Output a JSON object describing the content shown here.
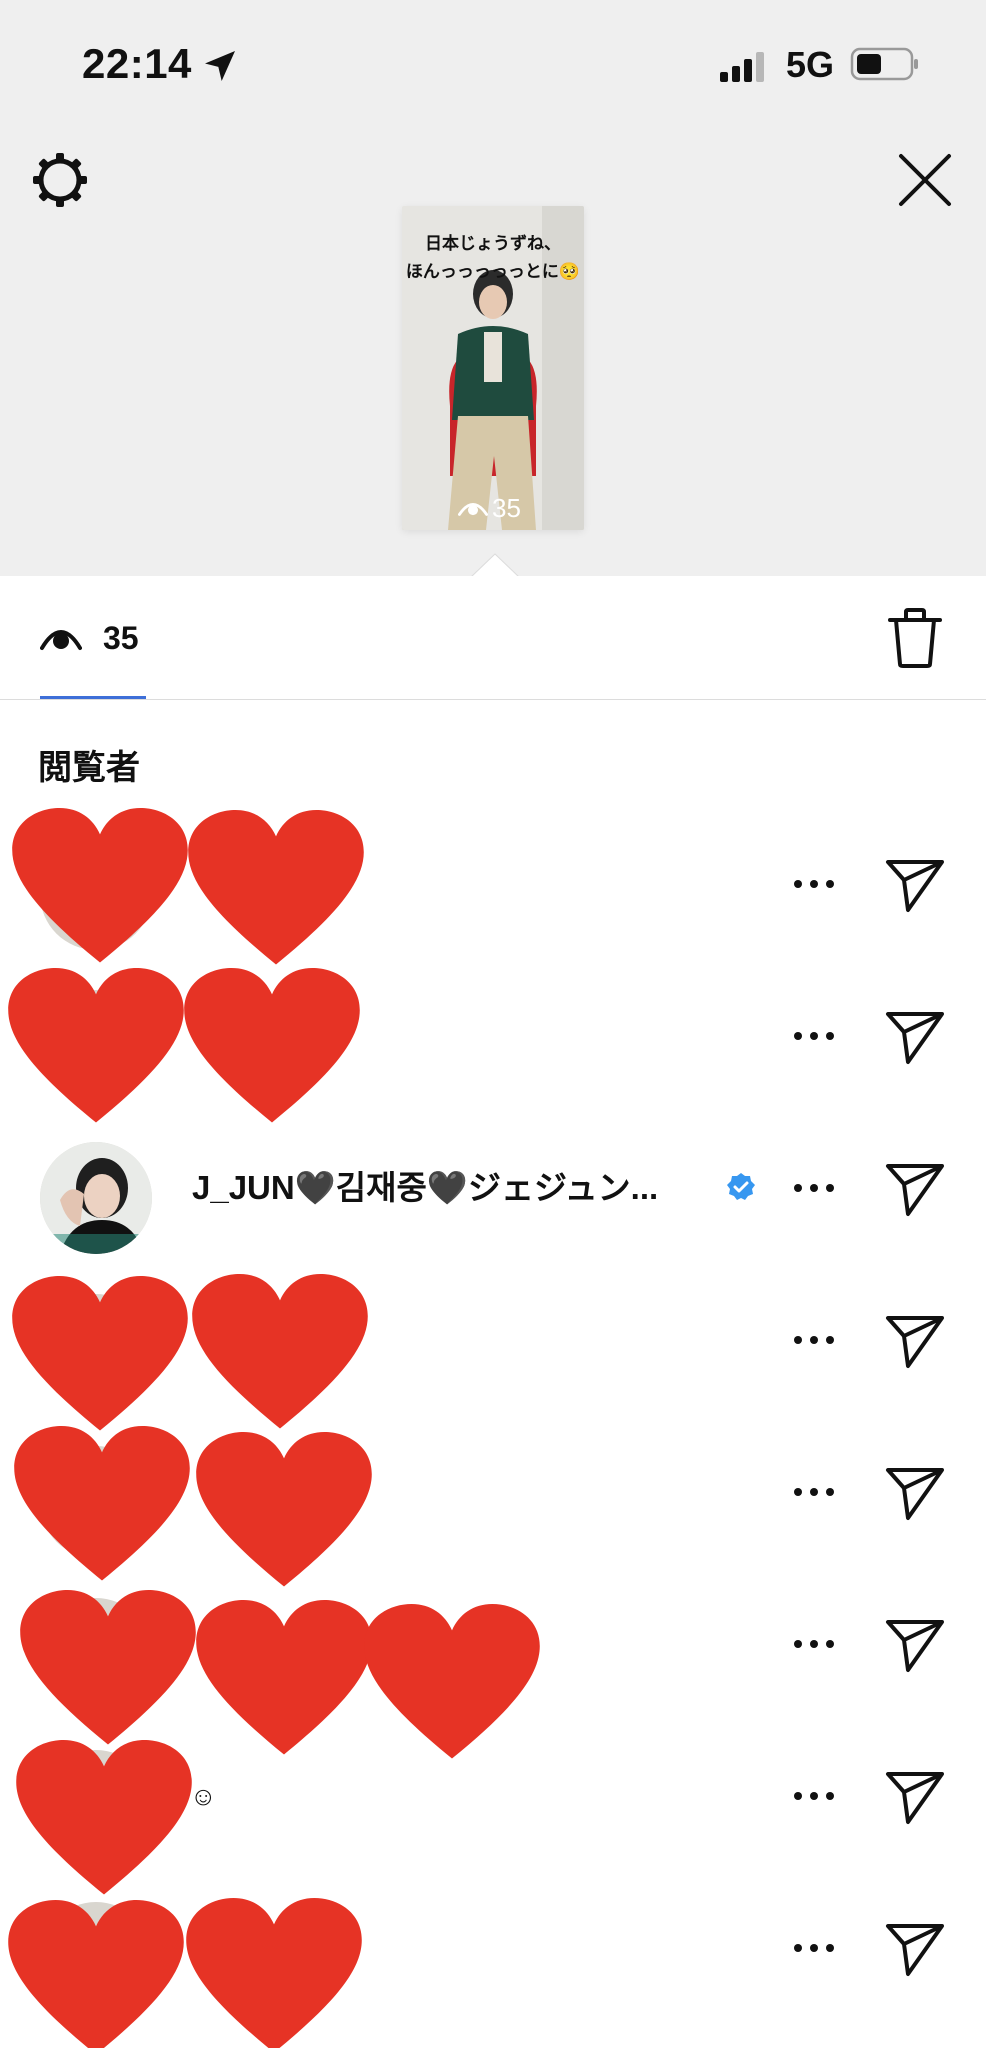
{
  "status_bar": {
    "time": "22:14",
    "network": "5G",
    "icons": [
      "location-arrow-icon",
      "signal-icon",
      "battery-icon"
    ]
  },
  "header": {
    "settings_icon": "gear-icon",
    "close_icon": "close-icon"
  },
  "story": {
    "caption_line1": "日本じょうずね、",
    "caption_line2": "ほんっっっっっとに🥺",
    "views": "35"
  },
  "stats": {
    "view_count": "35",
    "eye_icon": "eye-icon",
    "delete_icon": "trash-icon"
  },
  "viewers": {
    "title": "閲覧者",
    "items": [
      {
        "name": "",
        "suffix": "",
        "hidden": true
      },
      {
        "name": "",
        "suffix": "",
        "hidden": true
      },
      {
        "name": "J_JUN🖤김재중🖤ジェジュン...",
        "suffix": "",
        "hidden": false,
        "verified": true
      },
      {
        "name": "",
        "suffix": "",
        "hidden": true
      },
      {
        "name": "",
        "suffix": "",
        "hidden": true
      },
      {
        "name": "",
        "suffix": "",
        "hidden": true
      },
      {
        "name": "",
        "suffix": "☺",
        "hidden": true
      },
      {
        "name": "",
        "suffix": "",
        "hidden": true
      }
    ],
    "more_label": "•••"
  },
  "colors": {
    "heart": "#e63325",
    "verified": "#3797f0",
    "tab_underline": "#3e6fd8",
    "top_background": "#efefef"
  }
}
